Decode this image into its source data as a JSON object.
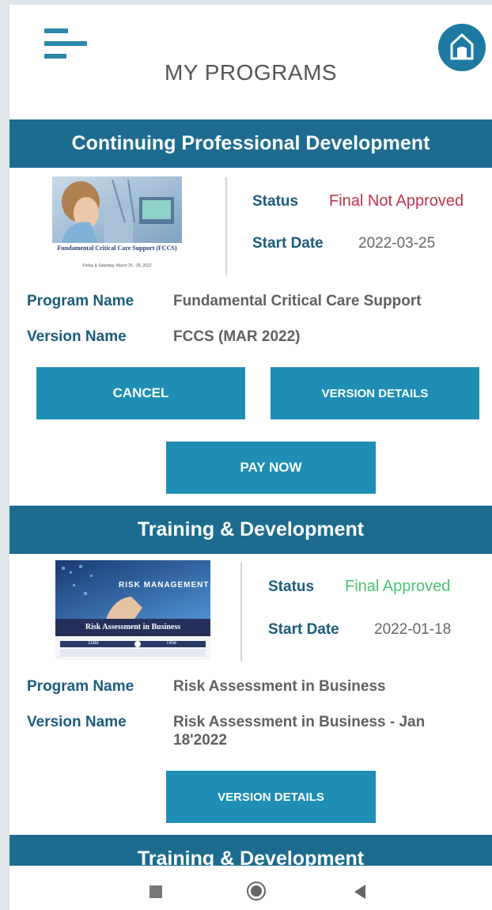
{
  "header": {
    "title": "MY PROGRAMS",
    "menu_icon": "hamburger-menu-icon",
    "home_icon": "home-icon"
  },
  "programs": [
    {
      "category": "Continuing Professional Development",
      "thumbnail": {
        "caption": "Fundamental Critical Care Support (FCCS)",
        "subcaption": "Friday & Saturday, March 25 - 26, 2022"
      },
      "status_label": "Status",
      "status_value": "Final Not Approved",
      "start_date_label": "Start Date",
      "start_date_value": "2022-03-25",
      "program_name_label": "Program Name",
      "program_name_value": "Fundamental Critical Care Support",
      "version_name_label": "Version Name",
      "version_name_value": "FCCS (MAR 2022)",
      "buttons": {
        "cancel": "CANCEL",
        "version_details": "VERSION DETAILS",
        "pay_now": "PAY NOW"
      }
    },
    {
      "category": "Training & Development",
      "thumbnail": {
        "banner": "RISK MANAGEMENT",
        "caption": "Risk Assessment in Business",
        "col_date": "Date",
        "col_time": "Time"
      },
      "status_label": "Status",
      "status_value": "Final Approved",
      "start_date_label": "Start Date",
      "start_date_value": "2022-01-18",
      "program_name_label": "Program Name",
      "program_name_value": "Risk Assessment in Business",
      "version_name_label": "Version Name",
      "version_name_line1": "Risk Assessment in Business - Jan",
      "version_name_line2": "18'2022",
      "buttons": {
        "version_details": "VERSION DETAILS"
      }
    },
    {
      "category": "Training & Development"
    }
  ],
  "colors": {
    "section_header": "#1d6c90",
    "button": "#1e8eb4",
    "label": "#1b5c7c",
    "status_not_approved": "#c0344c",
    "status_approved": "#4cc46f"
  },
  "navbar": {
    "recents": "square-icon",
    "home": "circle-icon",
    "back": "back-triangle-icon"
  }
}
